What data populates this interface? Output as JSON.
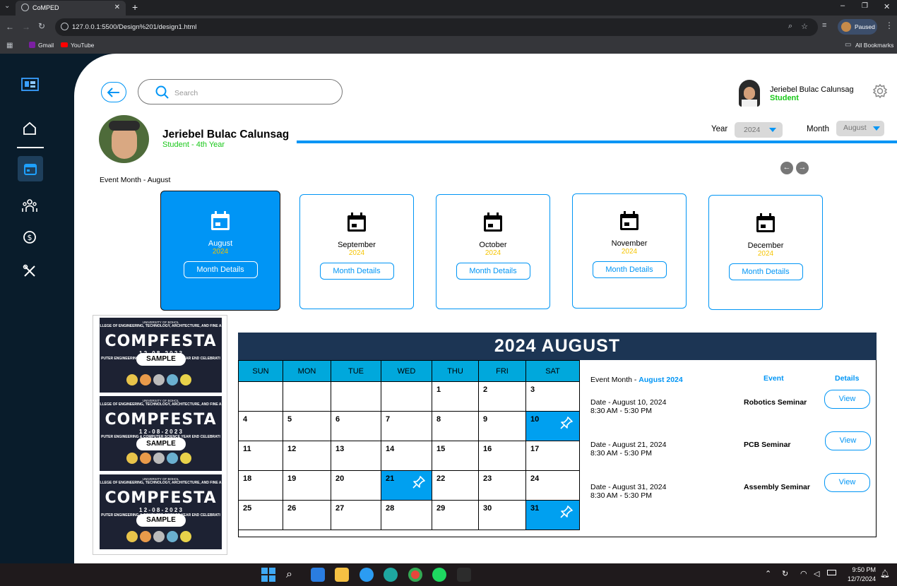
{
  "browser": {
    "tab_title": "CoMPED",
    "url": "127.0.0.1:5500/Design%201/design1.html",
    "profile_label": "Paused",
    "bookmarks": [
      "Gmail",
      "YouTube"
    ],
    "all_bookmarks": "All Bookmarks"
  },
  "header": {
    "search_placeholder": "Search",
    "user_name": "Jeriebel Bulac Calunsag",
    "user_role": "Student"
  },
  "profile": {
    "name": "Jeriebel Bulac Calunsag",
    "subtitle": "Student - 4th Year"
  },
  "filters": {
    "year_label": "Year",
    "year_value": "2024",
    "month_label": "Month",
    "month_value": "August"
  },
  "event_month_label": "Event Month - August",
  "months": [
    {
      "name": "August",
      "year": "2024",
      "button": "Month Details"
    },
    {
      "name": "September",
      "year": "2024",
      "button": "Month Details"
    },
    {
      "name": "October",
      "year": "2024",
      "button": "Month Details"
    },
    {
      "name": "November",
      "year": "2024",
      "button": "Month Details"
    },
    {
      "name": "December",
      "year": "2024",
      "button": "Month Details"
    }
  ],
  "posters": [
    {
      "top": "UNIVERSITY OF BOHOL",
      "line1": "LLEGE OF ENGINEERING, TECHNOLOGY, ARCHITECTURE, AND FINE A",
      "title": "COMPFESTA",
      "date": "1 2 - 0 8 - 2 0 2 3",
      "line2": "PUTER ENGINEERING & COMPUTER SCIENCE YEAR END CELEBRATI",
      "sample": "SAMPLE"
    },
    {
      "top": "UNIVERSITY OF BOHOL",
      "line1": "LLEGE OF ENGINEERING, TECHNOLOGY, ARCHITECTURE, AND FINE A",
      "title": "COMPFESTA",
      "date": "1 2 - 0 8 - 2 0 2 3",
      "line2": "PUTER ENGINEERING & COMPUTER SCIENCE YEAR END CELEBRATI",
      "sample": "SAMPLE"
    },
    {
      "top": "UNIVERSITY OF BOHOL",
      "line1": "LLEGE OF ENGINEERING, TECHNOLOGY, ARCHITECTURE, AND FINE A",
      "title": "COMPFESTA",
      "date": "1 2 - 0 8 - 2 0 2 3",
      "line2": "PUTER ENGINEERING & COMPUTER SCIENCE YEAR END CELEBRATI",
      "sample": "SAMPLE"
    }
  ],
  "calendar": {
    "title": "2024 AUGUST",
    "weekdays": [
      "SUN",
      "MON",
      "TUE",
      "WED",
      "THU",
      "FRI",
      "SAT"
    ],
    "weeks": [
      [
        "",
        "",
        "",
        "",
        "1",
        "2",
        "3"
      ],
      [
        "4",
        "5",
        "6",
        "7",
        "8",
        "9",
        "10"
      ],
      [
        "11",
        "12",
        "13",
        "14",
        "15",
        "16",
        "17"
      ],
      [
        "18",
        "19",
        "20",
        "21",
        "22",
        "23",
        "24"
      ],
      [
        "25",
        "26",
        "27",
        "28",
        "29",
        "30",
        "31"
      ]
    ],
    "event_days": [
      "10",
      "21",
      "31"
    ]
  },
  "events_panel": {
    "label": "Event Month - ",
    "month": "August 2024",
    "col_event": "Event",
    "col_details": "Details",
    "items": [
      {
        "date": "Date - August 10, 2024",
        "time": "8:30 AM - 5:30 PM",
        "name": "Robotics Seminar",
        "button": "View"
      },
      {
        "date": "Date - August 21, 2024",
        "time": "8:30 AM - 5:30 PM",
        "name": "PCB Seminar",
        "button": "View"
      },
      {
        "date": "Date - August 31, 2024",
        "time": "8:30 AM - 5:30 PM",
        "name": "Assembly Seminar",
        "button": "View"
      }
    ]
  },
  "taskbar": {
    "time": "9:50 PM",
    "date": "12/7/2024"
  },
  "colors": {
    "sidebar": "#091c2b",
    "accent": "#0095f5",
    "calendar_header": "#1c3554",
    "weekday_header": "#00a8dc",
    "student_green": "#19c819",
    "year_yellow": "#f5c400"
  }
}
